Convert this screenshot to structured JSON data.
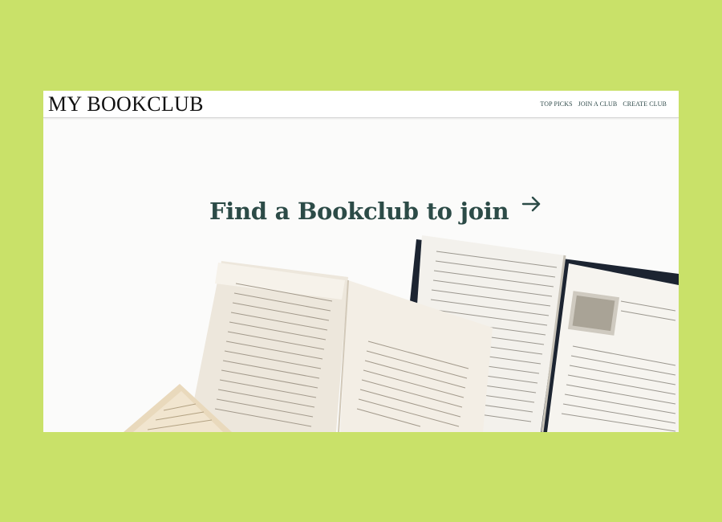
{
  "brand": {
    "title": "MY BOOKCLUB"
  },
  "nav": {
    "items": [
      "TOP PICKS",
      "JOIN A CLUB",
      "CREATE CLUB"
    ]
  },
  "hero": {
    "heading": "Find a Bookclub to join",
    "arrow_icon": "arrow-right-icon"
  },
  "colors": {
    "page_background": "#c9e169",
    "heading": "#2c4b47",
    "nav_link": "#2f4a4a"
  }
}
